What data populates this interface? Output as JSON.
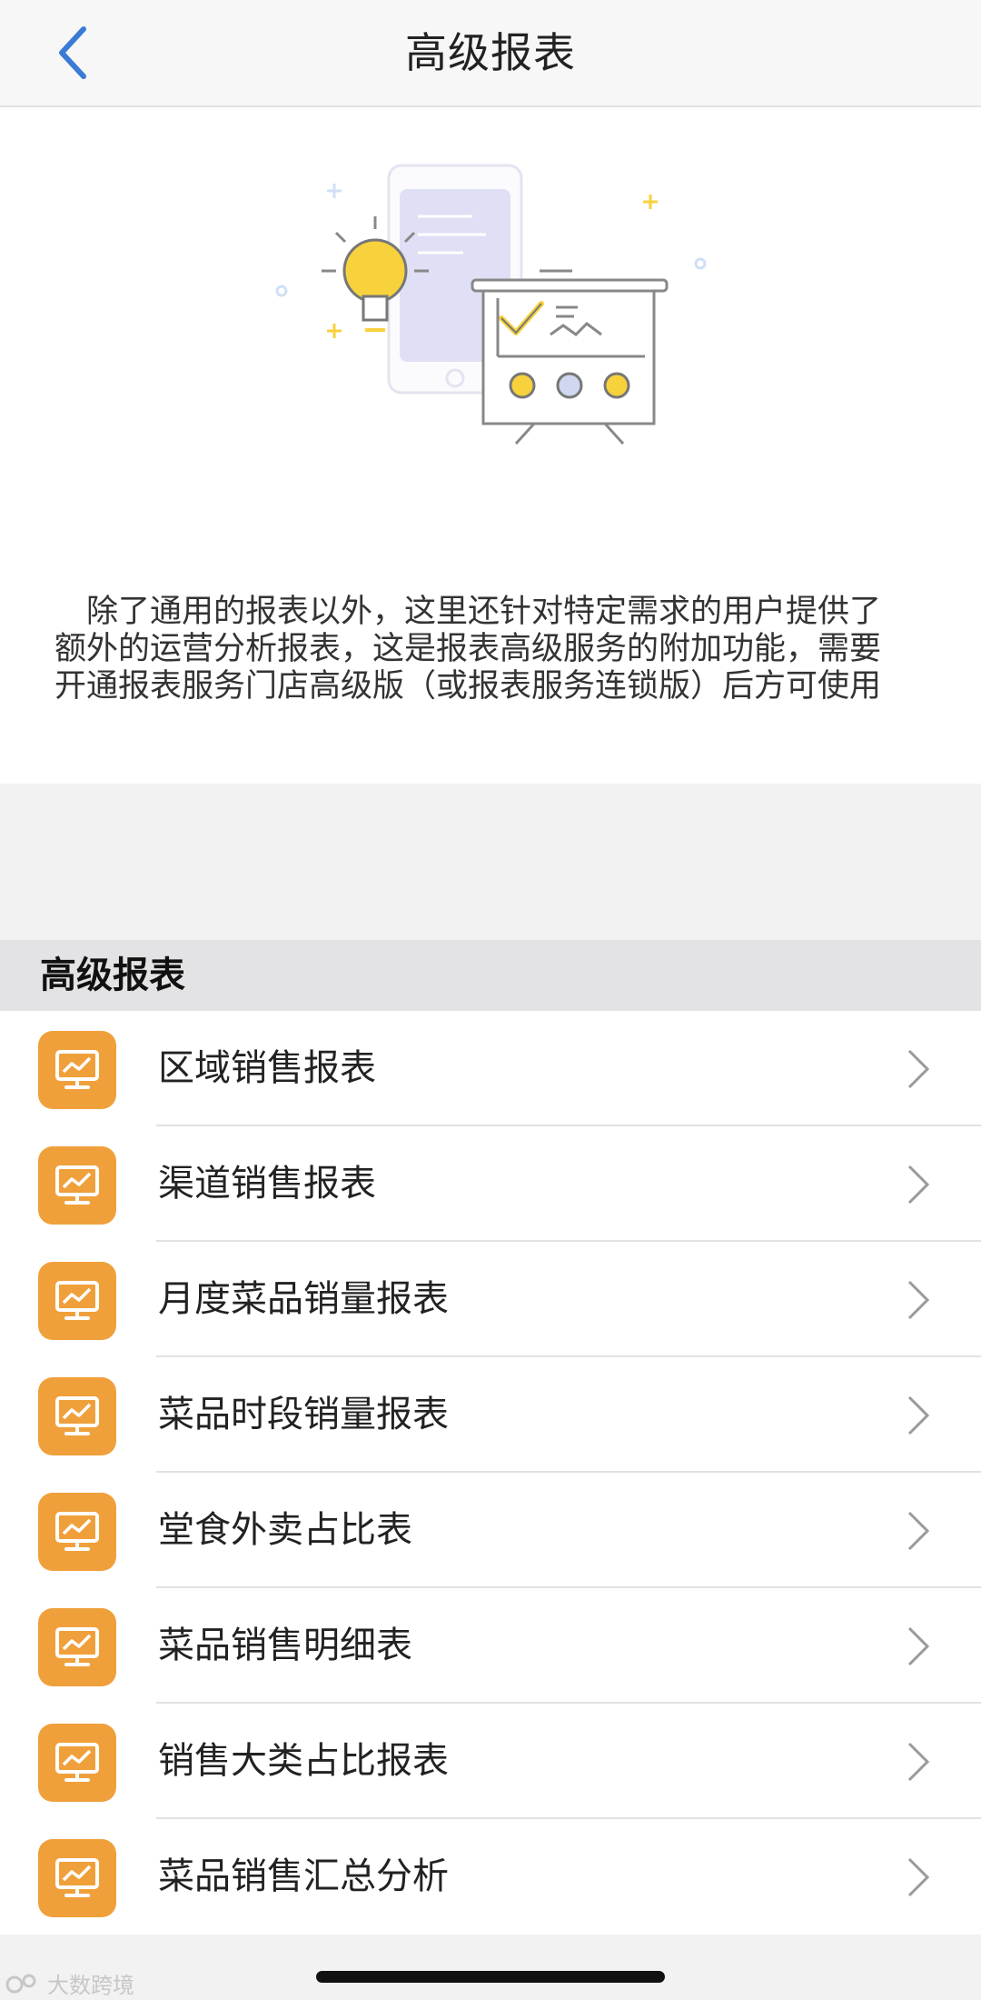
{
  "nav": {
    "title": "高级报表",
    "back_icon": "chevron-left-icon"
  },
  "intro": {
    "illustration": "phone-with-lightbulb-and-report-board-illustration",
    "description": "除了通用的报表以外，这里还针对特定需求的用户提供了额外的运营分析报表，这是报表高级服务的附加功能，需要开通报表服务门店高级版（或报表服务连锁版）后方可使用"
  },
  "section": {
    "title": "高级报表"
  },
  "reports": [
    {
      "label": "区域销售报表",
      "icon": "monitor-chart-icon"
    },
    {
      "label": "渠道销售报表",
      "icon": "monitor-chart-icon"
    },
    {
      "label": "月度菜品销量报表",
      "icon": "monitor-chart-icon"
    },
    {
      "label": "菜品时段销量报表",
      "icon": "monitor-chart-icon"
    },
    {
      "label": "堂食外卖占比表",
      "icon": "monitor-chart-icon"
    },
    {
      "label": "菜品销售明细表",
      "icon": "monitor-chart-icon"
    },
    {
      "label": "销售大类占比报表",
      "icon": "monitor-chart-icon"
    },
    {
      "label": "菜品销售汇总分析",
      "icon": "monitor-chart-icon"
    }
  ],
  "watermark": {
    "text": "大数跨境"
  },
  "colors": {
    "accent_blue": "#3a7bd5",
    "icon_orange": "#f0a03a",
    "illustration_yellow": "#f7d23c",
    "illustration_lavender": "#dfe0f5"
  }
}
